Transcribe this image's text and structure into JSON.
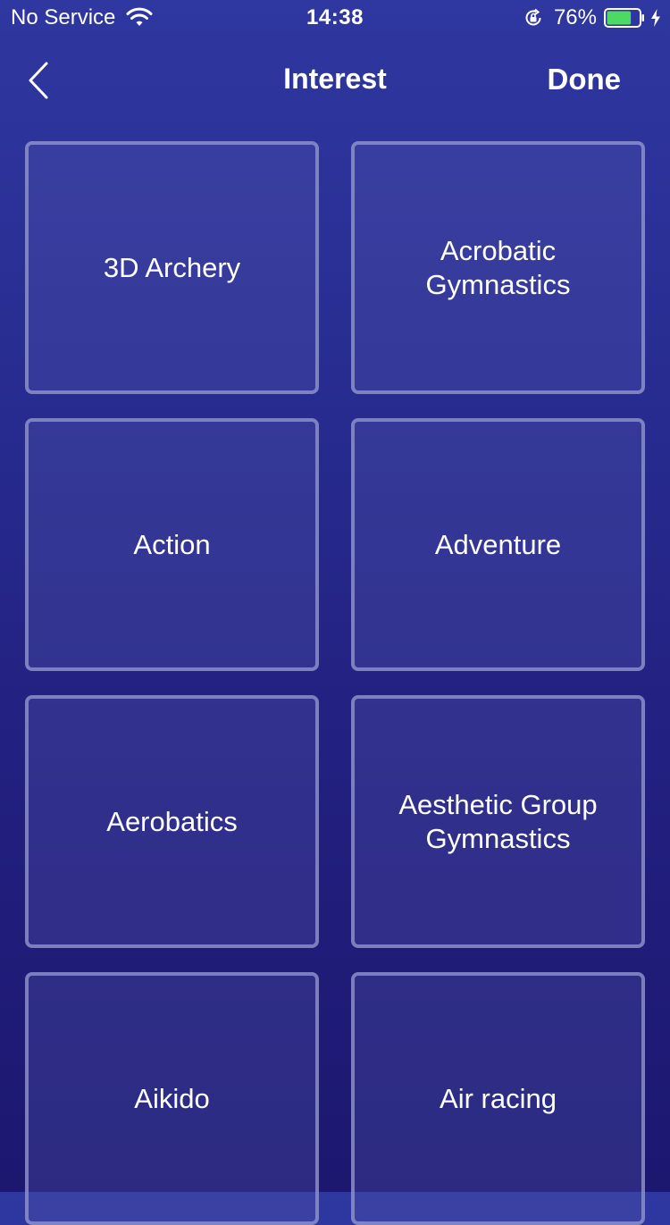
{
  "status_bar": {
    "carrier": "No Service",
    "time": "14:38",
    "battery_percent": "76%",
    "battery_level": 0.76,
    "battery_color": "#4cd964",
    "icons": [
      "wifi-icon",
      "rotation-lock-icon",
      "battery-icon",
      "charging-bolt-icon"
    ]
  },
  "nav": {
    "back_icon": "chevron-left-icon",
    "title": "Interest",
    "done_label": "Done"
  },
  "interests": [
    {
      "label": "3D Archery"
    },
    {
      "label": "Acrobatic Gymnastics"
    },
    {
      "label": "Action"
    },
    {
      "label": "Adventure"
    },
    {
      "label": "Aerobatics"
    },
    {
      "label": "Aesthetic Group Gymnastics"
    },
    {
      "label": "Aikido"
    },
    {
      "label": "Air racing"
    }
  ],
  "colors": {
    "background_top": "#2f37a0",
    "background_bottom": "#1c1870",
    "tile_border": "#969bcd"
  }
}
